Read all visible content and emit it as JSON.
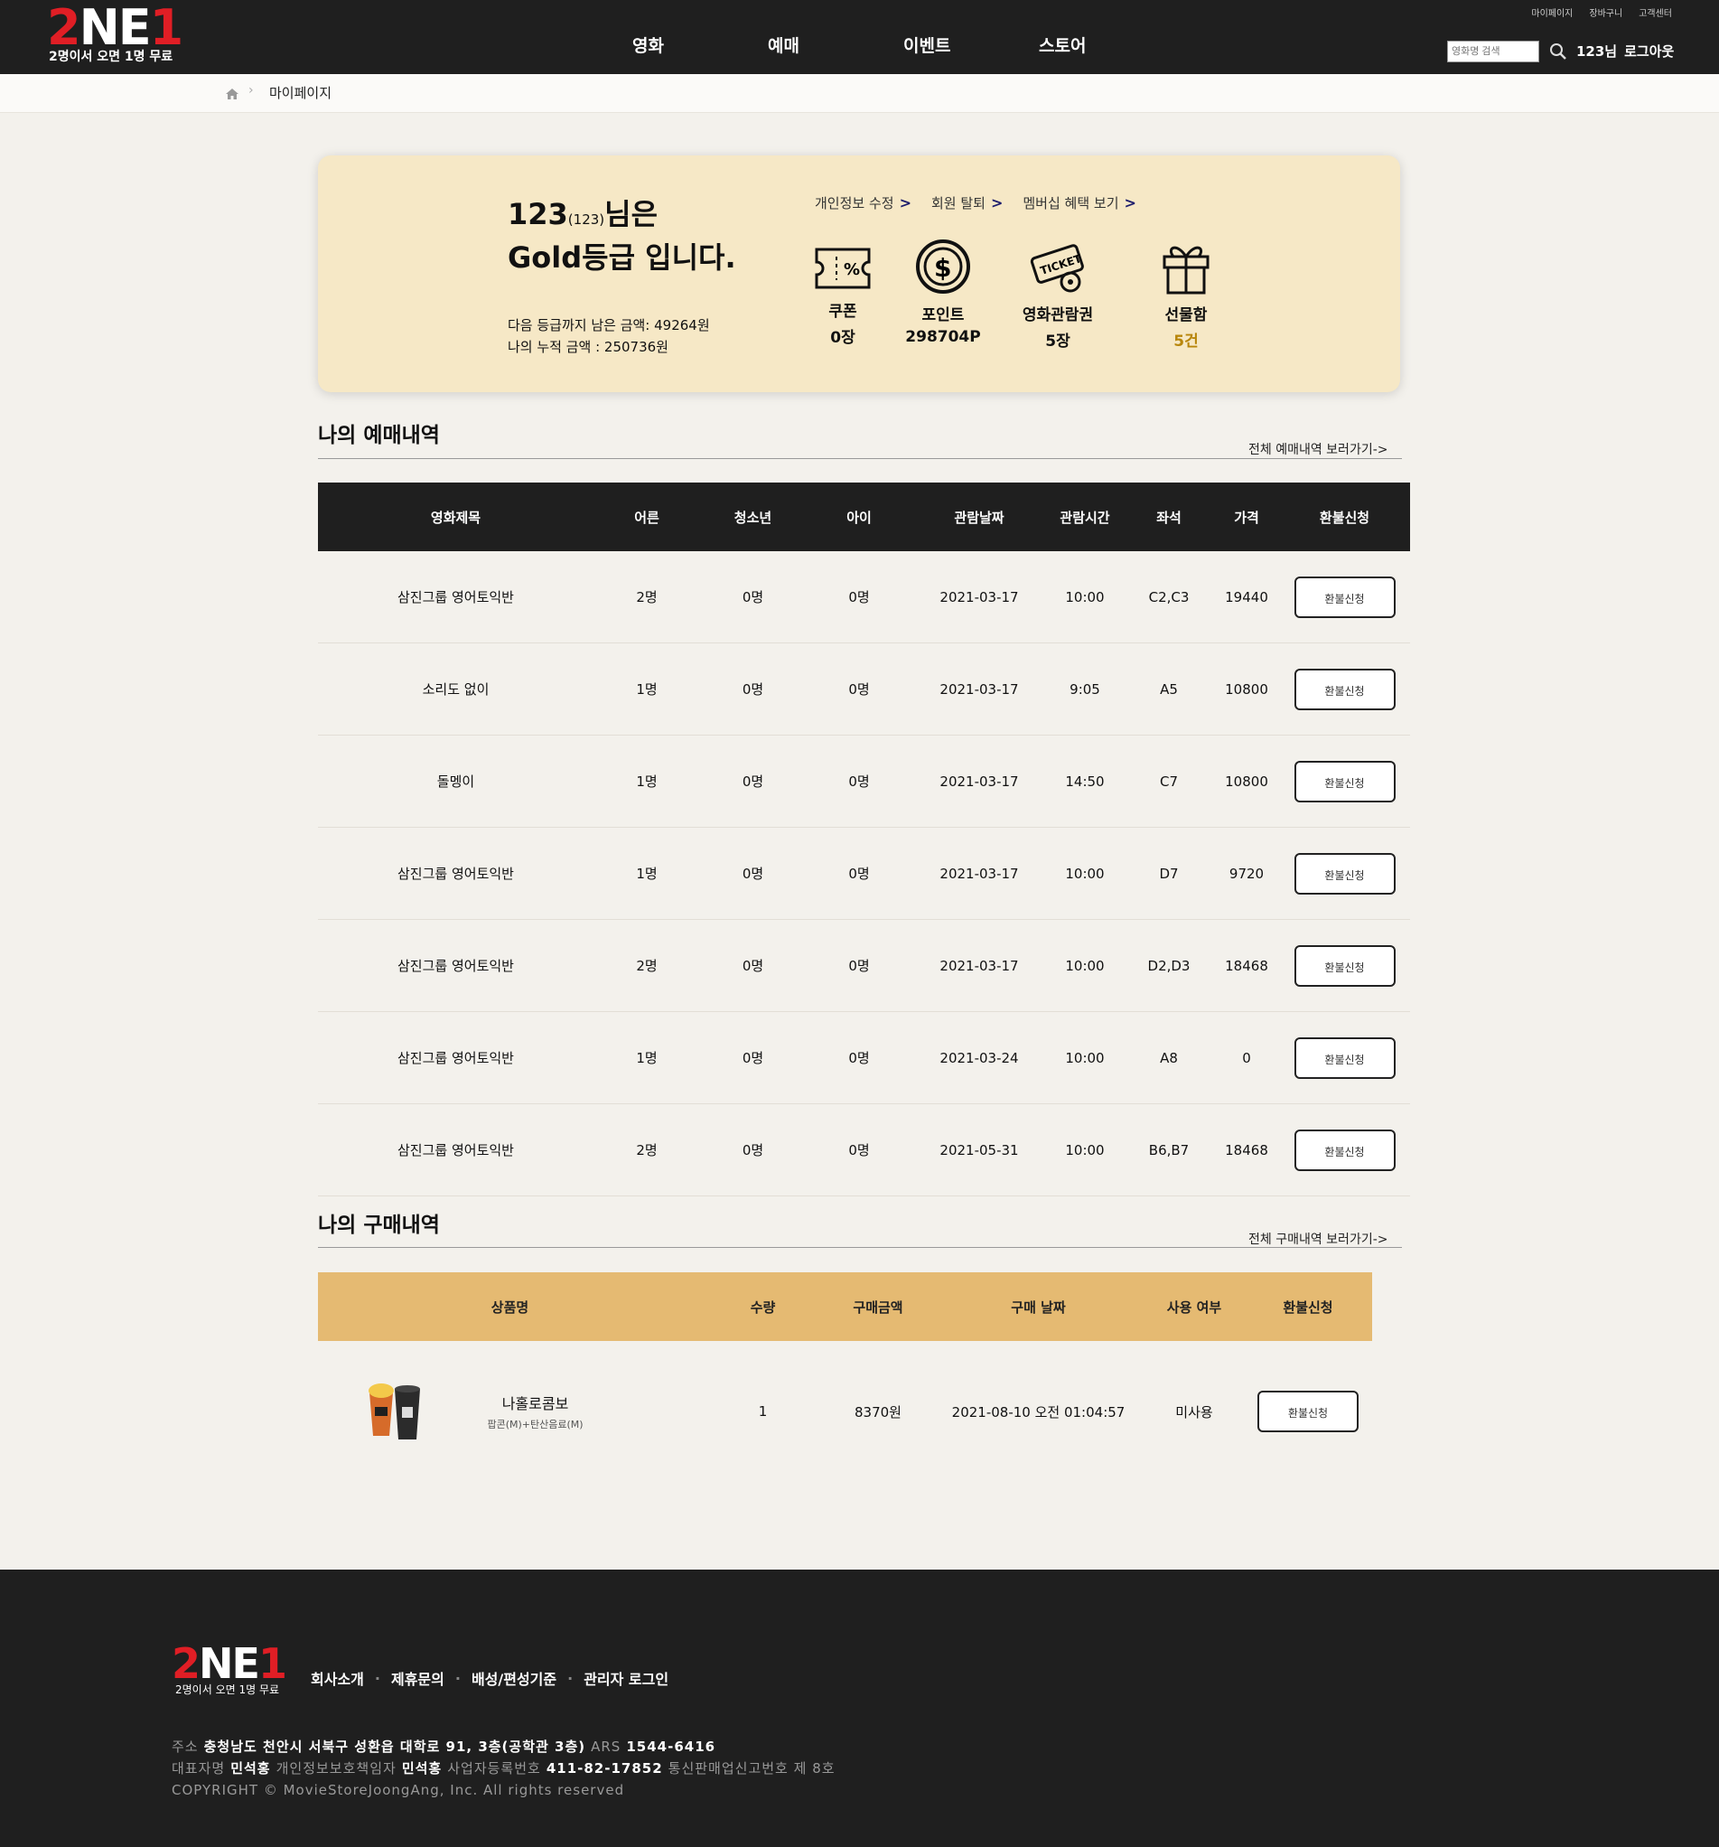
{
  "header": {
    "logo_main": "2NE1",
    "logo_sub": "2명이서 오면 1명 무료",
    "nav": [
      "영화",
      "예매",
      "이벤트",
      "스토어"
    ],
    "util_links": [
      "마이페이지",
      "장바구니",
      "고객센터"
    ],
    "search_placeholder": "영화명 검색",
    "user_label": "123님",
    "logout_label": "로그아웃"
  },
  "breadcrumb": {
    "current": "마이페이지"
  },
  "member": {
    "name": "123",
    "id_paren": "(123)",
    "greet_suffix": "님은",
    "grade_line": "Gold등급 입니다.",
    "next_grade_text": "다음 등급까지 남은 금액: 49264원",
    "total_text": "나의 누적 금액 : 250736원",
    "links": [
      "개인정보 수정",
      "회원 탈퇴",
      "멤버십 혜택 보기"
    ],
    "benefits": [
      {
        "label": "쿠폰",
        "value": "0장",
        "icon": "coupon-icon"
      },
      {
        "label": "포인트",
        "value": "298704P",
        "icon": "point-icon"
      },
      {
        "label": "영화관람권",
        "value": "5장",
        "icon": "ticket-icon"
      },
      {
        "label": "선물함",
        "value": "5건",
        "icon": "gift-icon"
      }
    ]
  },
  "reservations": {
    "title": "나의 예매내역",
    "more": "전체 예매내역 보러가기->",
    "columns": [
      "영화제목",
      "어른",
      "청소년",
      "아이",
      "관람날짜",
      "관람시간",
      "좌석",
      "가격",
      "환불신청"
    ],
    "rows": [
      [
        "삼진그룹 영어토익반",
        "2명",
        "0명",
        "0명",
        "2021-03-17",
        "10:00",
        "C2,C3",
        "19440"
      ],
      [
        "소리도 없이",
        "1명",
        "0명",
        "0명",
        "2021-03-17",
        "9:05",
        "A5",
        "10800"
      ],
      [
        "돌멩이",
        "1명",
        "0명",
        "0명",
        "2021-03-17",
        "14:50",
        "C7",
        "10800"
      ],
      [
        "삼진그룹 영어토익반",
        "1명",
        "0명",
        "0명",
        "2021-03-17",
        "10:00",
        "D7",
        "9720"
      ],
      [
        "삼진그룹 영어토익반",
        "2명",
        "0명",
        "0명",
        "2021-03-17",
        "10:00",
        "D2,D3",
        "18468"
      ],
      [
        "삼진그룹 영어토익반",
        "1명",
        "0명",
        "0명",
        "2021-03-24",
        "10:00",
        "A8",
        "0"
      ],
      [
        "삼진그룹 영어토익반",
        "2명",
        "0명",
        "0명",
        "2021-05-31",
        "10:00",
        "B6,B7",
        "18468"
      ]
    ],
    "refund_label": "환불신청"
  },
  "purchases": {
    "title": "나의 구매내역",
    "more": "전체 구매내역 보러가기->",
    "columns": [
      "상품명",
      "수량",
      "구매금액",
      "구매 날짜",
      "사용 여부",
      "환불신청"
    ],
    "rows": [
      {
        "name": "나홀로콤보",
        "desc": "팝콘(M)+탄산음료(M)",
        "qty": "1",
        "amount": "8370원",
        "date": "2021-08-10 오전 01:04:57",
        "status": "미사용"
      }
    ],
    "refund_label": "환불신청"
  },
  "footer": {
    "logo_main": "2NE1",
    "logo_sub": "2명이서 오면 1명 무료",
    "links": [
      "회사소개",
      "제휴문의",
      "배성/편성기준",
      "관리자 로그인"
    ],
    "address_label": "주소",
    "address": "충청남도 천안시 서북구 성환읍 대학로 91, 3층(공학관 3층)",
    "ars_label": "ARS",
    "ars": "1544-6416",
    "ceo_label": "대표자명",
    "ceo": "민석홍",
    "privacy_label": "개인정보보호책임자",
    "privacy": "민석홍",
    "bizno_label": "사업자등록번호",
    "bizno": "411-82-17852",
    "mailorder": "통신판매업신고번호 제 8호",
    "copyright": "COPYRIGHT © MovieStoreJoongAng, Inc. All rights reserved"
  }
}
